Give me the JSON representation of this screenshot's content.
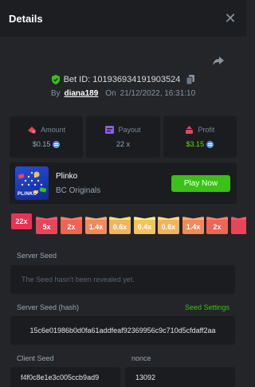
{
  "header": {
    "title": "Details",
    "close_glyph": "✕"
  },
  "bet": {
    "id_text": "Bet ID: 101936934191903524",
    "by_label": "By",
    "user": "diana189",
    "on_label": "On",
    "datetime": "21/12/2022, 16:31:10"
  },
  "stats": {
    "amount": {
      "label": "Amount",
      "value": "$0.15"
    },
    "payout": {
      "label": "Payout",
      "value": "22 x"
    },
    "profit": {
      "label": "Profit",
      "value": "$3.15"
    }
  },
  "game": {
    "name": "Plinko",
    "provider": "BC Originals",
    "play_label": "Play Now",
    "thumb_text": "PLINKO"
  },
  "multipliers": {
    "selected": "22x",
    "list": [
      "5x",
      "2x",
      "1.4x",
      "0.6x",
      "0.4x",
      "0.6x",
      "1.4x",
      "2x"
    ]
  },
  "seeds": {
    "server_seed_label": "Server Seed",
    "server_seed_placeholder": "The Seed hasn't been revealed yet.",
    "server_hash_label": "Server Seed (hash)",
    "seed_settings_label": "Seed Settings",
    "server_hash": "15c6e01986b0d0fa61addfeaf92369956c9c710d5cfdaff2aa",
    "client_seed_label": "Client Seed",
    "client_seed": "f4f0c8e1e3c005ccb9ad9",
    "nonce_label": "nonce",
    "nonce": "13092"
  },
  "colors": {
    "accent_green": "#3bc117",
    "profit_green": "#5ddb1c",
    "selected_multiplier": "#ea3354",
    "multiplier_colors": [
      "#e8455a",
      "#ee6455",
      "#f08a5c",
      "#f3b35d",
      "#f3c35e",
      "#f3b35d",
      "#f08a5c",
      "#ee6455"
    ]
  },
  "icons": {
    "close": "close-icon",
    "share": "share-icon",
    "shield": "shield-check-icon",
    "copy": "copy-icon",
    "amount": "money-icon",
    "payout": "payout-icon",
    "profit": "profit-icon",
    "coin": "coin-icon"
  }
}
